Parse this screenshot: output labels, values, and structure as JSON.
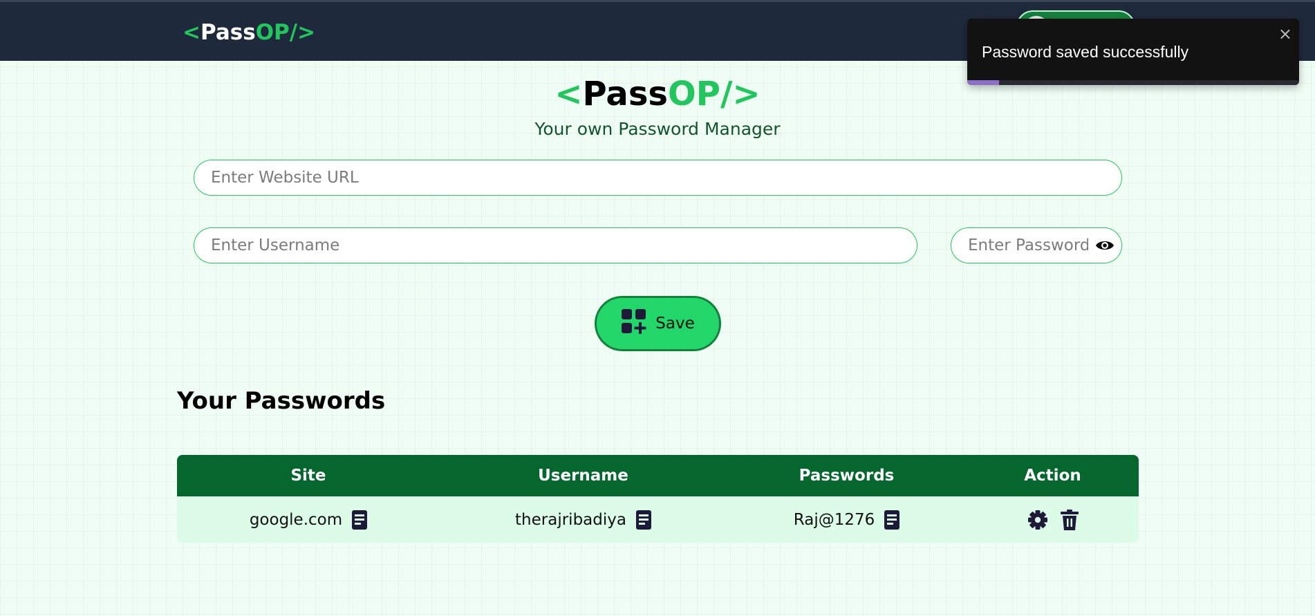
{
  "brand": {
    "lt": "<",
    "pass": "Pass",
    "op": "OP/",
    "gt": ">"
  },
  "tagline": "Your own Password Manager",
  "form": {
    "url_placeholder": "Enter Website URL",
    "username_placeholder": "Enter Username",
    "password_placeholder": "Enter Password",
    "save_label": "Save"
  },
  "section_title": "Your Passwords",
  "table": {
    "headers": [
      "Site",
      "Username",
      "Passwords",
      "Action"
    ],
    "rows": [
      {
        "site": "google.com",
        "username": "therajribadiya",
        "password": "Raj@1276"
      }
    ]
  },
  "toast": {
    "message": "Password saved successfully",
    "close": "×",
    "progress": 0.095
  },
  "icons": {
    "show_password": "eye-icon",
    "save": "add-grid-icon",
    "copy": "copy-clipboard-icon",
    "edit": "gear-icon",
    "delete": "trash-icon"
  },
  "colors": {
    "accent": "#22c55e",
    "nav_bg": "#1e293b",
    "table_header": "#05662e",
    "table_row": "#dcfce7",
    "button": "#22d66a",
    "toast_bg": "#121212",
    "toast_progress": "#8b6fc9"
  }
}
